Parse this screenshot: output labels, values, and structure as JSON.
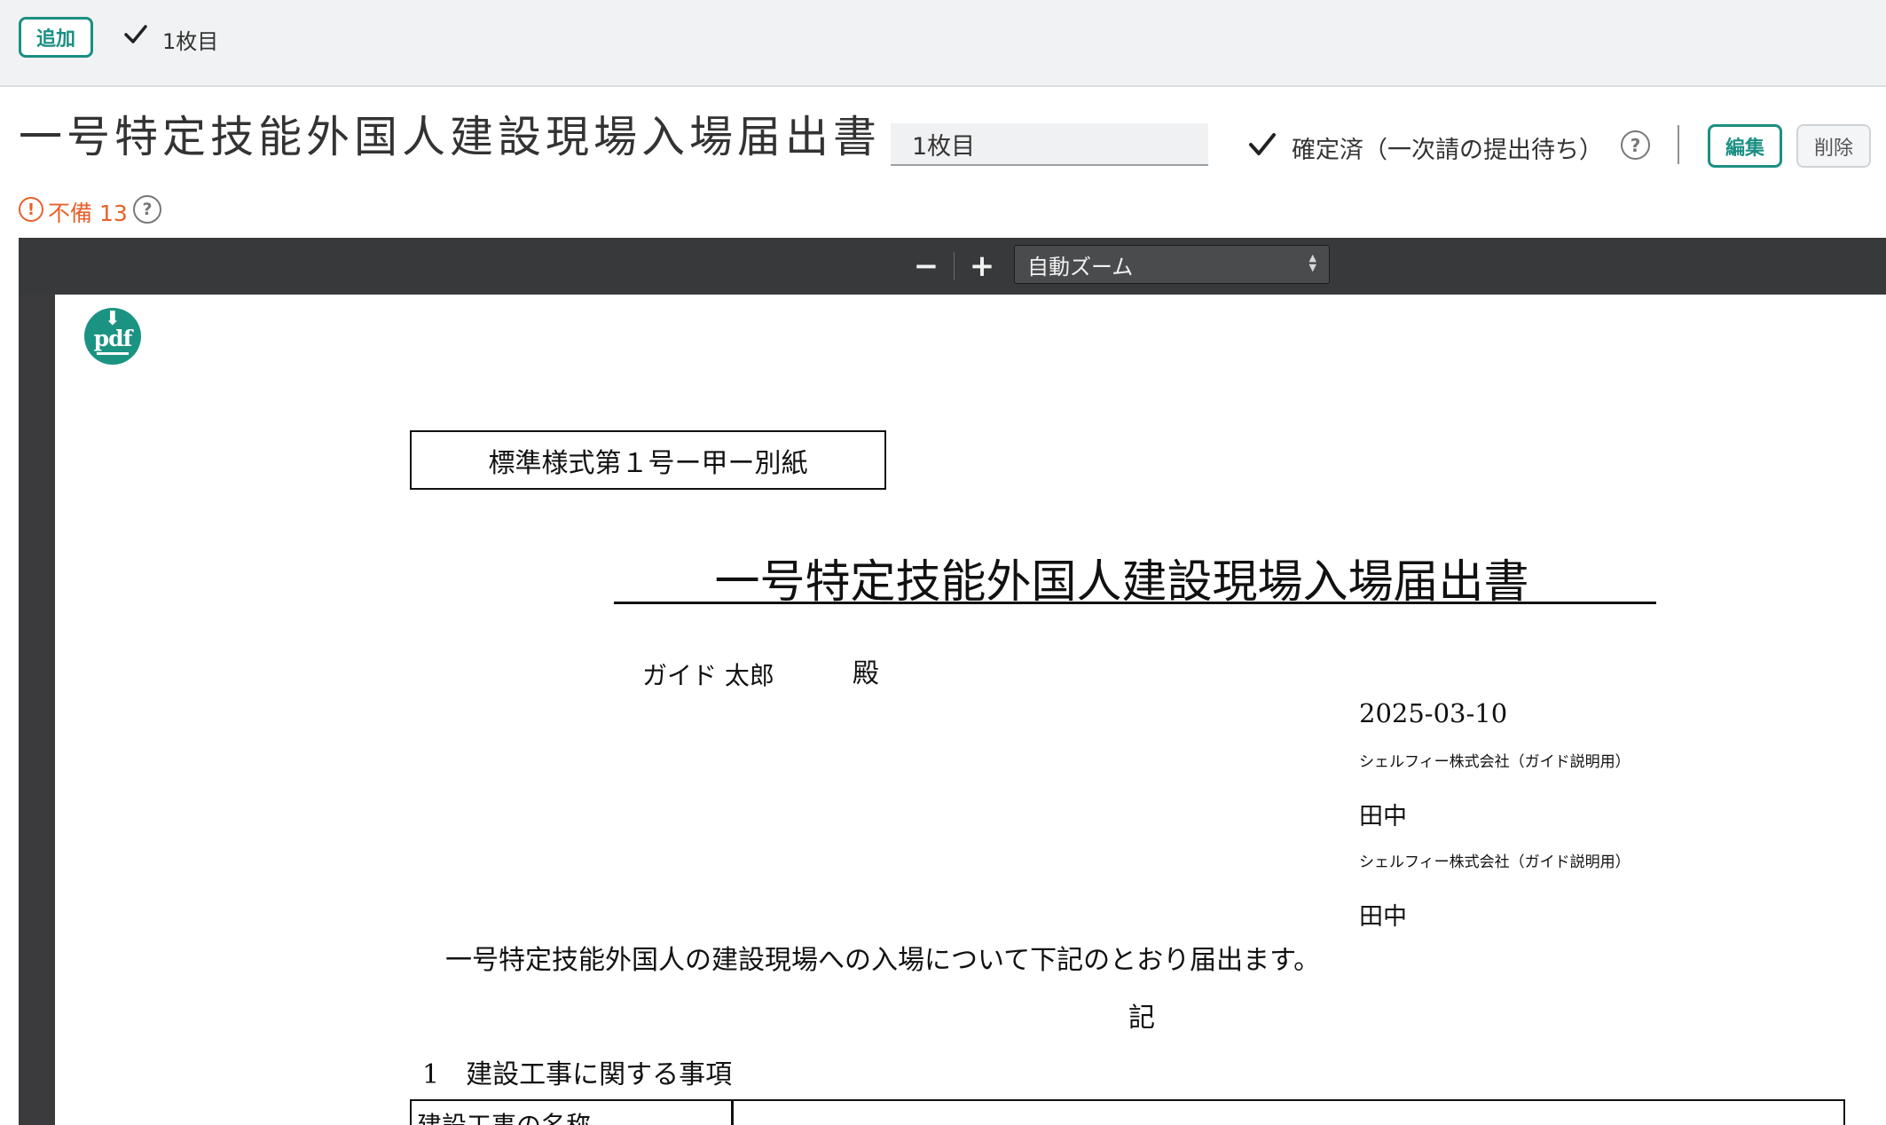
{
  "tabs": {
    "add_label": "追加",
    "active_tab_label": "1枚目"
  },
  "header": {
    "title": "一号特定技能外国人建設現場入場届出書",
    "sheet_name_value": "1枚目",
    "status_text": "確定済（一次請の提出待ち）",
    "edit_label": "編集",
    "delete_label": "削除",
    "defect_text": "不備 13"
  },
  "viewer": {
    "zoom_out_label": "−",
    "zoom_in_label": "+",
    "zoom_value": "自動ズーム",
    "download_label": "pdf"
  },
  "document": {
    "form_code": "標準様式第１号ー甲ー別紙",
    "title": "一号特定技能外国人建設現場入場届出書",
    "addressee": "ガイド 太郎",
    "honorific": "殿",
    "date": "2025-03-10",
    "company_1": "シェルフィー株式会社（ガイド説明用）",
    "person_1": "田中",
    "company_2": "シェルフィー株式会社（ガイド説明用）",
    "person_2": "田中",
    "statement": "一号特定技能外国人の建設現場への入場について下記のとおり届出ます。",
    "ki": "記",
    "section_1": "1　建設工事に関する事項",
    "table_first_cell": "建設工事の名称"
  },
  "colors": {
    "accent": "#1b8f84",
    "warning": "#e8612c",
    "toolbar_bg": "#38393b"
  },
  "icons": [
    "check-icon",
    "help-icon",
    "alert-icon",
    "download-pdf-icon",
    "minus-icon",
    "plus-icon",
    "select-arrows-icon"
  ]
}
